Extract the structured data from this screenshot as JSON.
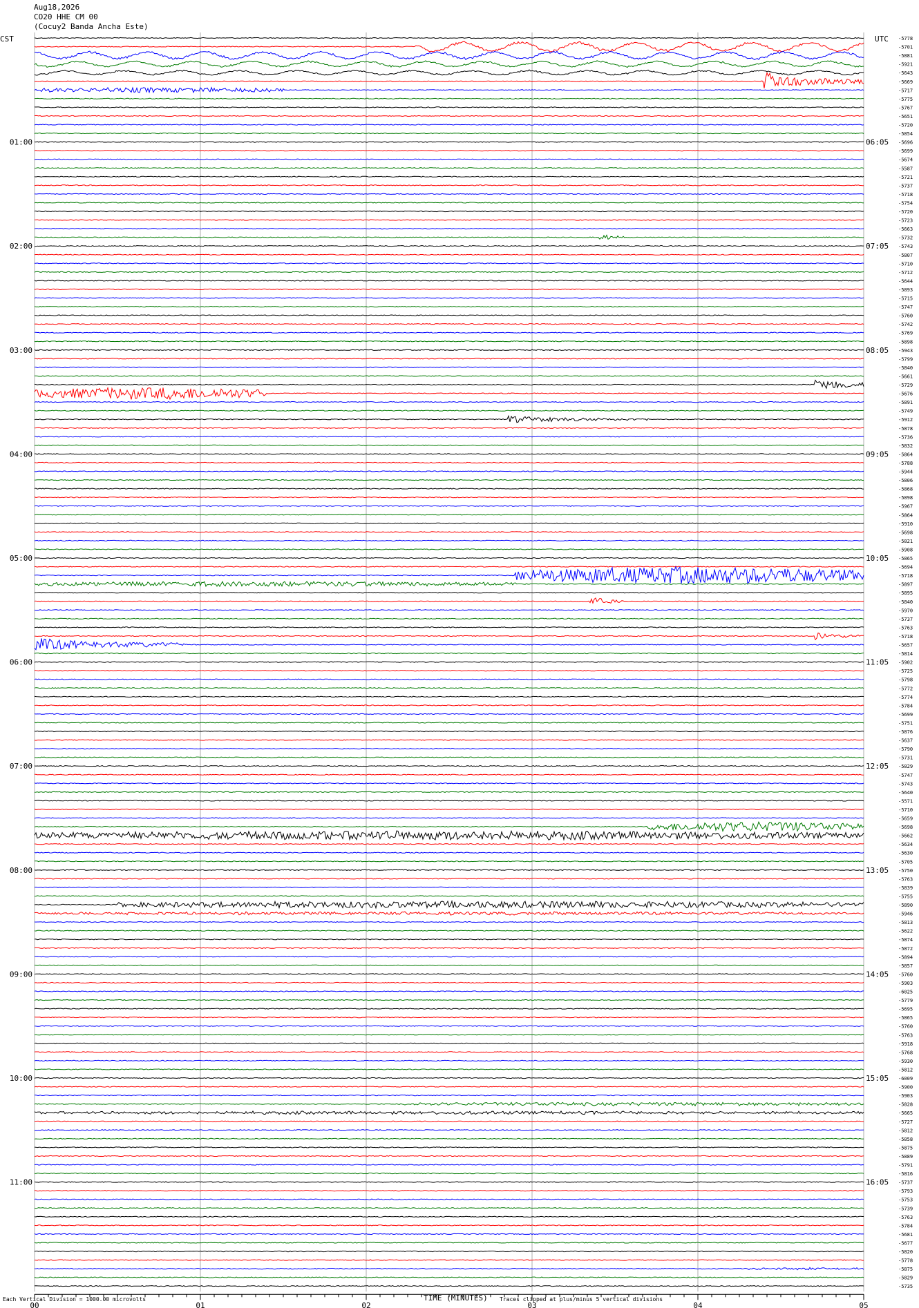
{
  "header": {
    "date": "Aug18,2026",
    "channel": "CO20 HHE CM 00",
    "site": "(Cocuy2 Banda Ancha Este)",
    "left_timezone": "CST",
    "right_timezone": "UTC"
  },
  "footer": {
    "scale_note": "Each Vertical Division = 1000.00 microvolts",
    "x_axis_label": "TIME (MINUTES)",
    "clip_note": "Traces clipped at plus/minus 5 vertical divisions"
  },
  "colors": {
    "trace_cycle": [
      "#000000",
      "#ff0000",
      "#0000ff",
      "#007a00"
    ],
    "grid": "#999999",
    "background": "#ffffff"
  },
  "chart_data": {
    "type": "line",
    "title": "Aug18,2026",
    "subtitle": "CO20 HHE CM 00 (Cocuy2 Banda Ancha Este)",
    "xlabel": "TIME (MINUTES)",
    "x_ticks": [
      "00",
      "01",
      "02",
      "03",
      "04",
      "05"
    ],
    "xlim": [
      0,
      5
    ],
    "left_time_labels": [
      "01:00",
      "02:00",
      "03:00",
      "04:00",
      "05:00",
      "06:00",
      "07:00",
      "08:00",
      "09:00",
      "10:00",
      "11:00"
    ],
    "right_time_labels": [
      "06:05",
      "07:05",
      "08:05",
      "09:05",
      "10:05",
      "11:05",
      "12:05",
      "13:05",
      "14:05",
      "15:05",
      "16:05"
    ],
    "first_label_row": 12,
    "rows_per_hour": 12,
    "grid": true,
    "trace_offsets": [
      "-5778",
      "-5701",
      "-5881",
      "-5921",
      "-5643",
      "-5669",
      "-5717",
      "-5775",
      "-5767",
      "-5651",
      "-5720",
      "-5854",
      "-5696",
      "-5699",
      "-5674",
      "-5587",
      "-5721",
      "-5737",
      "-5718",
      "-5754",
      "-5720",
      "-5723",
      "-5663",
      "-5732",
      "-5743",
      "-5807",
      "-5710",
      "-5712",
      "-5644",
      "-5893",
      "-5715",
      "-5747",
      "-5760",
      "-5742",
      "-5769",
      "-5898",
      "-5943",
      "-5799",
      "-5840",
      "-5661",
      "-5729",
      "-5676",
      "-5891",
      "-5749",
      "-5912",
      "-5878",
      "-5736",
      "-5832",
      "-5864",
      "-5788",
      "-5944",
      "-5806",
      "-5868",
      "-5898",
      "-5967",
      "-5864",
      "-5910",
      "-5698",
      "-5821",
      "-5908",
      "-5865",
      "-5694",
      "-5718",
      "-5897",
      "-5895",
      "-5840",
      "-5970",
      "-5737",
      "-5763",
      "-5718",
      "-5657",
      "-5814",
      "-5902",
      "-5725",
      "-5798",
      "-5772",
      "-5774",
      "-5784",
      "-5699",
      "-5751",
      "-5876",
      "-5637",
      "-5790",
      "-5731",
      "-5829",
      "-5747",
      "-5743",
      "-5640",
      "-5571",
      "-5710",
      "-5659",
      "-5698",
      "-5662",
      "-5634",
      "-5630",
      "-5705",
      "-5750",
      "-5763",
      "-5839",
      "-5755",
      "-5890",
      "-5946",
      "-5813",
      "-5622",
      "-5874",
      "-5872",
      "-5894",
      "-5857",
      "-5760",
      "-5903",
      "-6025",
      "-5779",
      "-5695",
      "-5865",
      "-5760",
      "-5763",
      "-5918",
      "-5768",
      "-5930",
      "-5812",
      "-6009",
      "-5900",
      "-5903",
      "-5828",
      "-5665",
      "-5727",
      "-5812",
      "-5858",
      "-5875",
      "-5889",
      "-5791",
      "-5816",
      "-5737",
      "-5793",
      "-5753",
      "-5739",
      "-5763",
      "-5784",
      "-5681",
      "-5677",
      "-5820",
      "-5778",
      "-5875",
      "-5829",
      "-5735"
    ],
    "events": [
      {
        "row": 1,
        "start_min": 2.3,
        "end_min": 5.0,
        "amp": 1.5,
        "style": "wave"
      },
      {
        "row": 2,
        "start_min": 0.0,
        "end_min": 5.0,
        "amp": 1.2,
        "style": "wave"
      },
      {
        "row": 3,
        "start_min": 0.0,
        "end_min": 5.0,
        "amp": 0.9,
        "style": "wave"
      },
      {
        "row": 4,
        "start_min": 0.0,
        "end_min": 5.0,
        "amp": 0.7,
        "style": "wave"
      },
      {
        "row": 5,
        "start_min": 4.4,
        "end_min": 5.0,
        "amp": 2.0,
        "style": "burst"
      },
      {
        "row": 6,
        "start_min": 0.0,
        "end_min": 1.5,
        "amp": 1.0,
        "style": "noise"
      },
      {
        "row": 23,
        "start_min": 3.4,
        "end_min": 3.55,
        "amp": 1.0,
        "style": "burst"
      },
      {
        "row": 41,
        "start_min": 0.0,
        "end_min": 1.4,
        "amp": 2.5,
        "style": "noise"
      },
      {
        "row": 40,
        "start_min": 4.7,
        "end_min": 5.0,
        "amp": 1.8,
        "style": "burst"
      },
      {
        "row": 44,
        "start_min": 2.85,
        "end_min": 3.7,
        "amp": 0.8,
        "style": "burst"
      },
      {
        "row": 62,
        "start_min": 2.9,
        "end_min": 5.0,
        "amp": 3.5,
        "style": "noise"
      },
      {
        "row": 63,
        "start_min": 0.0,
        "end_min": 2.9,
        "amp": 1.0,
        "style": "noise"
      },
      {
        "row": 65,
        "start_min": 3.35,
        "end_min": 3.55,
        "amp": 1.2,
        "style": "burst"
      },
      {
        "row": 69,
        "start_min": 4.7,
        "end_min": 5.0,
        "amp": 1.0,
        "style": "burst"
      },
      {
        "row": 70,
        "start_min": 0.0,
        "end_min": 0.9,
        "amp": 1.6,
        "style": "burst"
      },
      {
        "row": 91,
        "start_min": 3.7,
        "end_min": 5.0,
        "amp": 2.0,
        "style": "noise"
      },
      {
        "row": 92,
        "start_min": 0.0,
        "end_min": 5.0,
        "amp": 1.8,
        "style": "noise"
      },
      {
        "row": 100,
        "start_min": 0.5,
        "end_min": 5.0,
        "amp": 1.4,
        "style": "noise"
      },
      {
        "row": 101,
        "start_min": 0.0,
        "end_min": 5.0,
        "amp": 0.6,
        "style": "noise"
      },
      {
        "row": 123,
        "start_min": 2.2,
        "end_min": 5.0,
        "amp": 0.7,
        "style": "noise"
      },
      {
        "row": 124,
        "start_min": 0.0,
        "end_min": 5.0,
        "amp": 0.6,
        "style": "noise"
      },
      {
        "row": 142,
        "start_min": 4.3,
        "end_min": 5.0,
        "amp": 0.4,
        "style": "noise"
      }
    ]
  }
}
